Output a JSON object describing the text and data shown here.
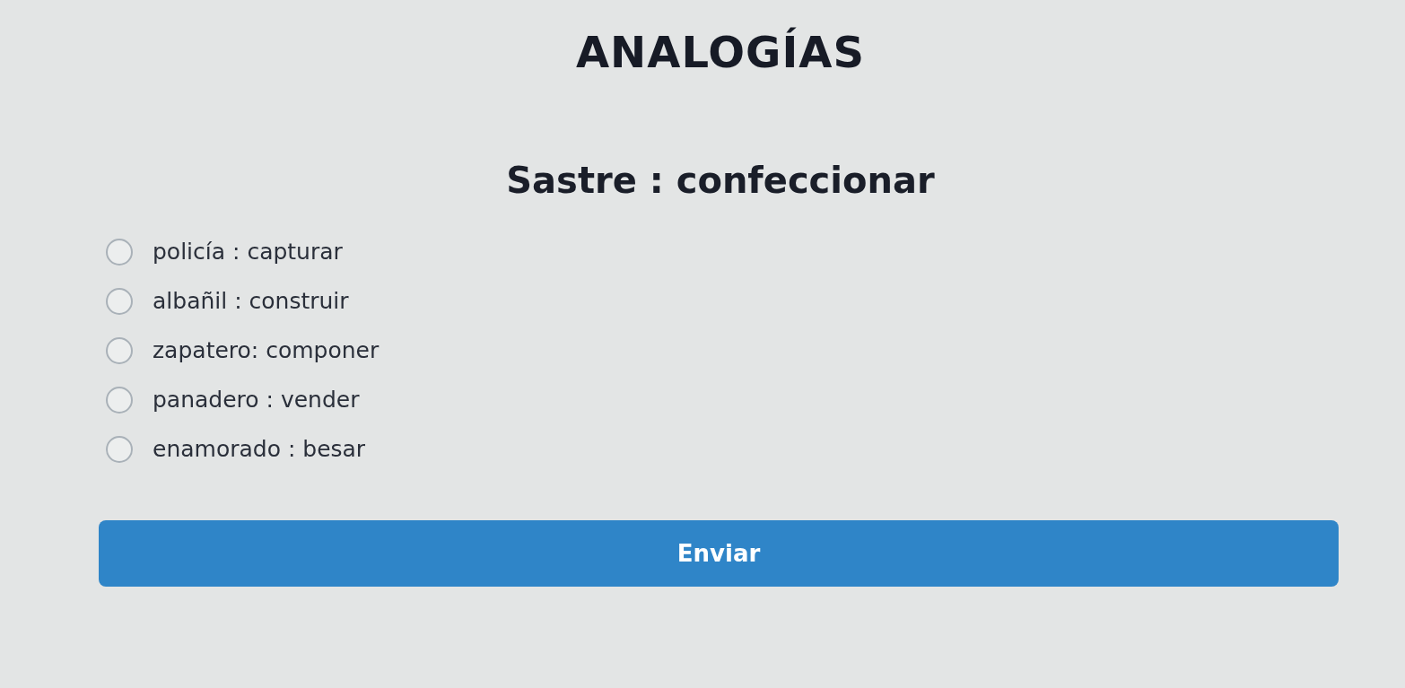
{
  "title": "ANALOGÍAS",
  "question": "Sastre : confeccionar",
  "options": [
    {
      "label": "policía : capturar",
      "selected": false
    },
    {
      "label": "albañil : construir",
      "selected": false
    },
    {
      "label": "zapatero: componer",
      "selected": false
    },
    {
      "label": "panadero : vender",
      "selected": false
    },
    {
      "label": "enamorado : besar",
      "selected": false
    }
  ],
  "submit_button": "Enviar"
}
